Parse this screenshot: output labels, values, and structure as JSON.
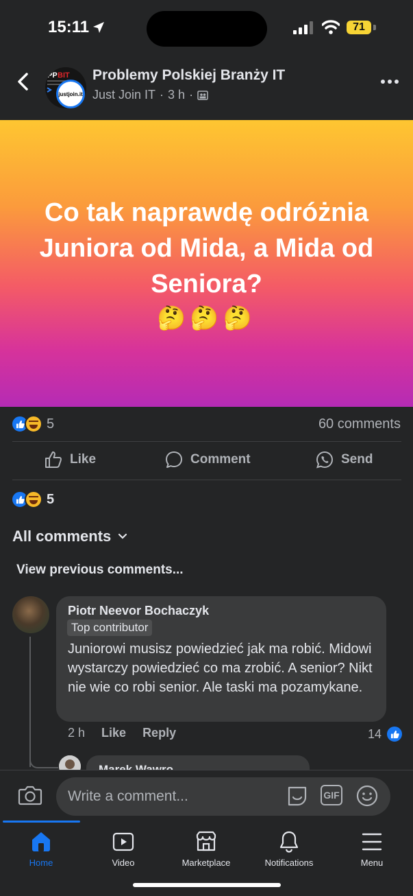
{
  "status": {
    "time": "15:11",
    "battery": "71"
  },
  "post": {
    "group_name": "Problemy Polskiej Branży IT",
    "author": "Just Join IT",
    "time": "3 h",
    "badge_text": "justjoin.it",
    "banner_text": "Co tak naprawdę odróżnia Juniora od Mida, a Mida od Seniora?",
    "banner_emoji": "🤔🤔🤔",
    "reaction_count": "5",
    "comments_count": "60 comments"
  },
  "actions": {
    "like": "Like",
    "comment": "Comment",
    "send": "Send"
  },
  "comments_section": {
    "reaction_count": "5",
    "all_comments": "All comments",
    "view_previous": "View previous comments..."
  },
  "comment": {
    "author": "Piotr Neevor Bochaczyk",
    "badge": "Top contributor",
    "text": "Juniorowi musisz powiedzieć jak ma robić. Midowi wystarczy powiedzieć co ma zrobić. A senior? Nikt nie wie co robi senior. Ale taski ma pozamykane.",
    "time": "2 h",
    "like": "Like",
    "reply": "Reply",
    "likes": "14"
  },
  "reply": {
    "author": "Marek Wawro"
  },
  "composer": {
    "placeholder": "Write a comment...",
    "gif": "GIF"
  },
  "tabs": [
    {
      "label": "Home",
      "icon": "home-icon"
    },
    {
      "label": "Video",
      "icon": "video-icon"
    },
    {
      "label": "Marketplace",
      "icon": "marketplace-icon"
    },
    {
      "label": "Notifications",
      "icon": "bell-icon"
    },
    {
      "label": "Menu",
      "icon": "menu-icon"
    }
  ],
  "colors": {
    "accent": "#1877f2",
    "background": "#242526",
    "bubble": "#3a3b3c"
  }
}
